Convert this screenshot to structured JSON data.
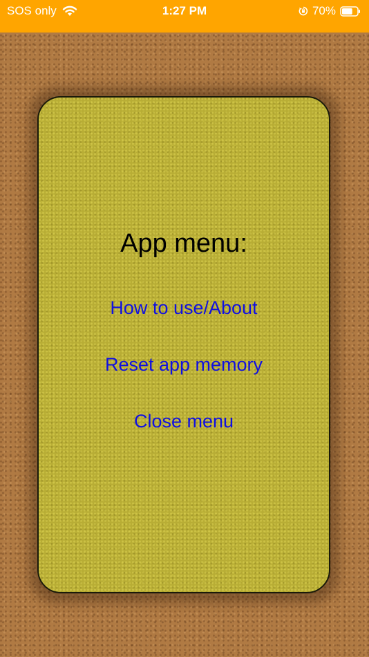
{
  "status_bar": {
    "carrier": "SOS only",
    "time": "1:27 PM",
    "battery_percent": "70%",
    "battery_level": 0.7,
    "background_color": "#ffa500",
    "icons": [
      "wifi-icon",
      "orientation-lock-icon",
      "battery-icon"
    ]
  },
  "menu": {
    "title": "App menu:",
    "items": [
      {
        "label": "How to use/About"
      },
      {
        "label": "Reset app memory"
      },
      {
        "label": "Close menu"
      }
    ],
    "link_color": "#1010e0",
    "card_color": "#b8ad35"
  }
}
